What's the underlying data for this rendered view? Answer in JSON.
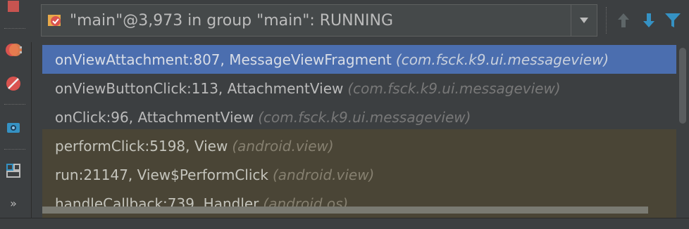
{
  "thread_selector": {
    "icon": "thread-status-icon",
    "text": "\"main\"@3,973 in group \"main\": RUNNING",
    "dropdown_icon": "triangle-down-icon"
  },
  "toolbar": {
    "up_icon": "arrow-up-icon",
    "down_icon": "arrow-down-icon",
    "filter_icon": "filter-icon"
  },
  "left_strip": {
    "items": [
      {
        "icon": "stop-icon"
      },
      {
        "icon": "view-breakpoints-icon"
      },
      {
        "icon": "mute-breakpoints-icon"
      },
      {
        "icon": "camera-icon"
      },
      {
        "icon": "layout-icon"
      },
      {
        "icon": "more-icon",
        "label": "»"
      }
    ]
  },
  "frames": [
    {
      "method": "onViewAttachment:807, MessageViewFragment",
      "pkg": "(com.fsck.k9.ui.messageview)",
      "state": "selected"
    },
    {
      "method": "onViewButtonClick:113, AttachmentView",
      "pkg": "(com.fsck.k9.ui.messageview)",
      "state": "normal"
    },
    {
      "method": "onClick:96, AttachmentView",
      "pkg": "(com.fsck.k9.ui.messageview)",
      "state": "normal"
    },
    {
      "method": "performClick:5198, View",
      "pkg": "(android.view)",
      "state": "library"
    },
    {
      "method": "run:21147, View$PerformClick",
      "pkg": "(android.view)",
      "state": "library"
    },
    {
      "method": "handleCallback:739, Handler",
      "pkg": "(android.os)",
      "state": "library"
    }
  ],
  "colors": {
    "selected": "#4b6eaf",
    "library": "#4a4536",
    "accent_blue": "#3592c4"
  }
}
